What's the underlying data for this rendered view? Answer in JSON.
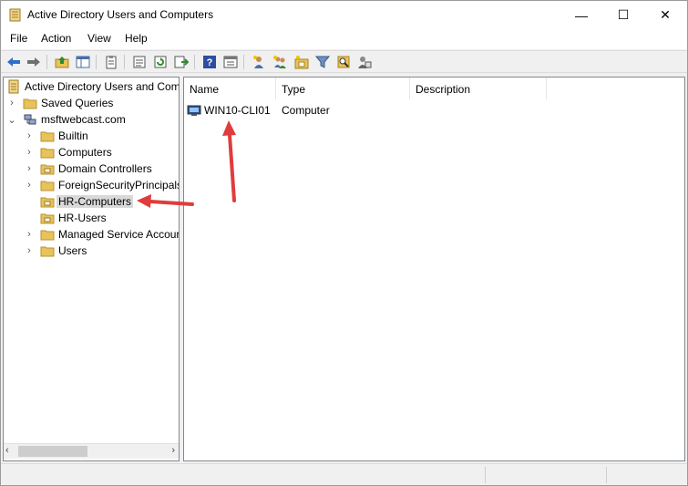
{
  "window": {
    "title": "Active Directory Users and Computers",
    "controls": {
      "minimize": "—",
      "maximize": "☐",
      "close": "✕"
    }
  },
  "menu": {
    "items": [
      "File",
      "Action",
      "View",
      "Help"
    ]
  },
  "toolbar": {
    "icons": [
      "back-arrow-icon",
      "forward-arrow-icon",
      "up-folder-icon",
      "show-tree-icon",
      "clipboard-icon",
      "properties-icon",
      "refresh-icon",
      "export-list-icon",
      "help-icon",
      "console-view-icon",
      "new-user-icon",
      "new-group-icon",
      "new-ou-icon",
      "filter-icon",
      "find-icon",
      "delegate-icon"
    ]
  },
  "tree": {
    "root": "Active Directory Users and Com",
    "saved_queries": "Saved Queries",
    "domain": "msftwebcast.com",
    "containers": [
      {
        "label": "Builtin",
        "type": "folder",
        "expandable": true
      },
      {
        "label": "Computers",
        "type": "folder",
        "expandable": true
      },
      {
        "label": "Domain Controllers",
        "type": "ou",
        "expandable": true
      },
      {
        "label": "ForeignSecurityPrincipals",
        "type": "folder",
        "expandable": true
      },
      {
        "label": "HR-Computers",
        "type": "ou",
        "expandable": false,
        "selected": true
      },
      {
        "label": "HR-Users",
        "type": "ou",
        "expandable": false
      },
      {
        "label": "Managed Service Accour",
        "type": "folder",
        "expandable": true
      },
      {
        "label": "Users",
        "type": "folder",
        "expandable": true
      }
    ]
  },
  "list": {
    "columns": [
      "Name",
      "Type",
      "Description"
    ],
    "rows": [
      {
        "name": "WIN10-CLI01",
        "type": "Computer",
        "description": ""
      }
    ]
  },
  "colors": {
    "annotation_arrow": "#e03c3c",
    "selection": "#d9d9d9",
    "folder": "#e8c25a"
  }
}
